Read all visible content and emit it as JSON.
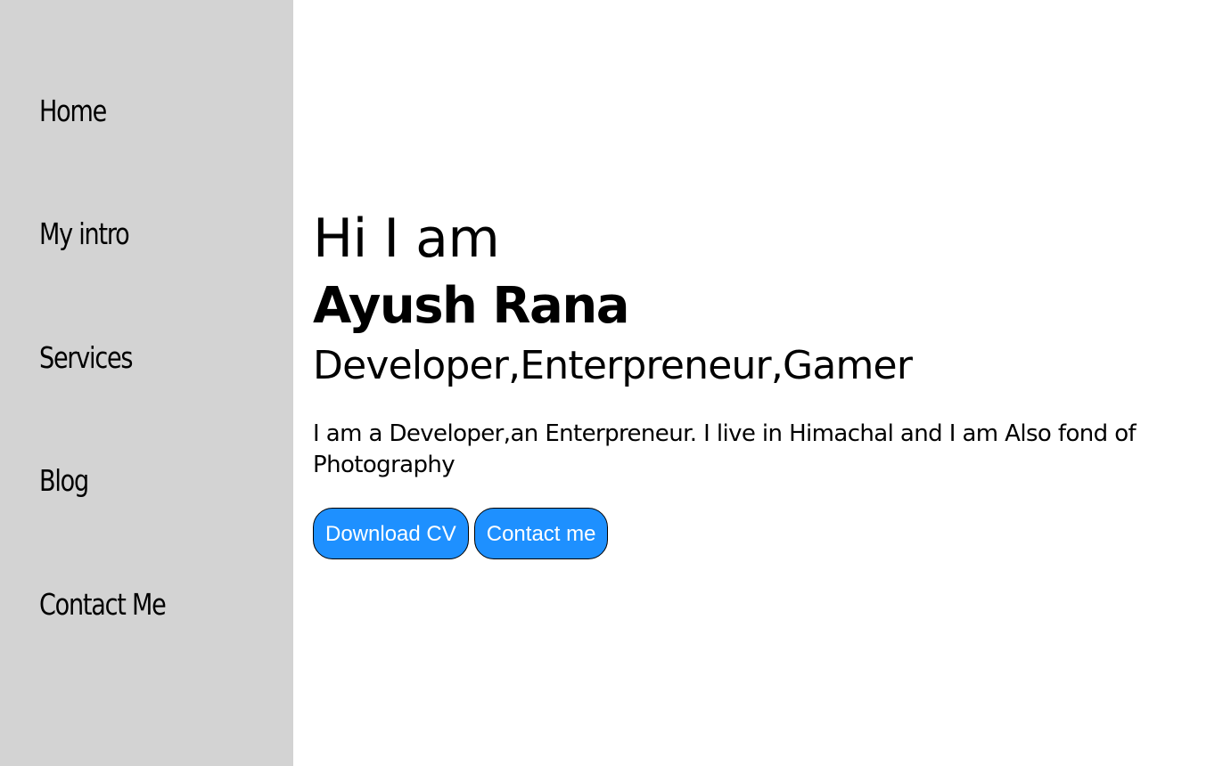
{
  "sidebar": {
    "items": [
      {
        "label": "Home"
      },
      {
        "label": "My intro"
      },
      {
        "label": "Services"
      },
      {
        "label": "Blog"
      },
      {
        "label": "Contact Me"
      }
    ],
    "background": "#d3d3d3"
  },
  "hero": {
    "greeting": "Hi I am",
    "name": "Ayush Rana",
    "roles": "Developer,Enterpreneur,Gamer",
    "bio": "I am a Developer,an Enterpreneur. I live in Himachal and I am Also fond of Photography"
  },
  "buttons": {
    "download_cv": "Download CV",
    "contact_me": "Contact me",
    "color": "#1e90ff"
  }
}
